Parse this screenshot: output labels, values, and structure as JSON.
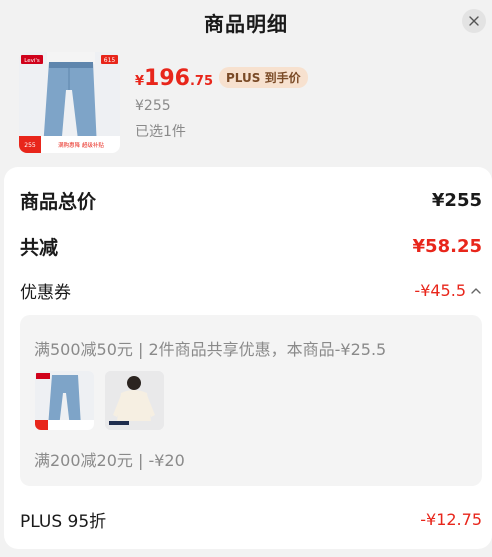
{
  "header": {
    "title": "商品明细"
  },
  "product": {
    "currency": "¥",
    "price_int": "196",
    "price_dec": ".75",
    "plus_tag": "PLUS 到手价",
    "original_price": "¥255",
    "selected_text": "已选1件",
    "thumb_brand": "Levi's",
    "thumb_badge": "615",
    "thumb_price": "255",
    "thumb_promo": "满购惠降 超级补贴"
  },
  "summary": {
    "total_label": "商品总价",
    "total_value": "¥255",
    "discount_label": "共减",
    "discount_value": "¥58.25",
    "coupon_label": "优惠券",
    "coupon_value": "-¥45.5",
    "coupon_rule_1": "满500减50元 | 2件商品共享优惠，本商品-¥25.5",
    "coupon_rule_2": "满200减20元 | -¥20",
    "plus_label": "PLUS 95折",
    "plus_value": "-¥12.75"
  },
  "colors": {
    "accent_red": "#e8261b",
    "plus_tag_bg": "#f7e1cf",
    "plus_tag_text": "#7a4a26"
  },
  "icons": {
    "close": "close-icon",
    "collapse": "chevron-up-icon"
  }
}
